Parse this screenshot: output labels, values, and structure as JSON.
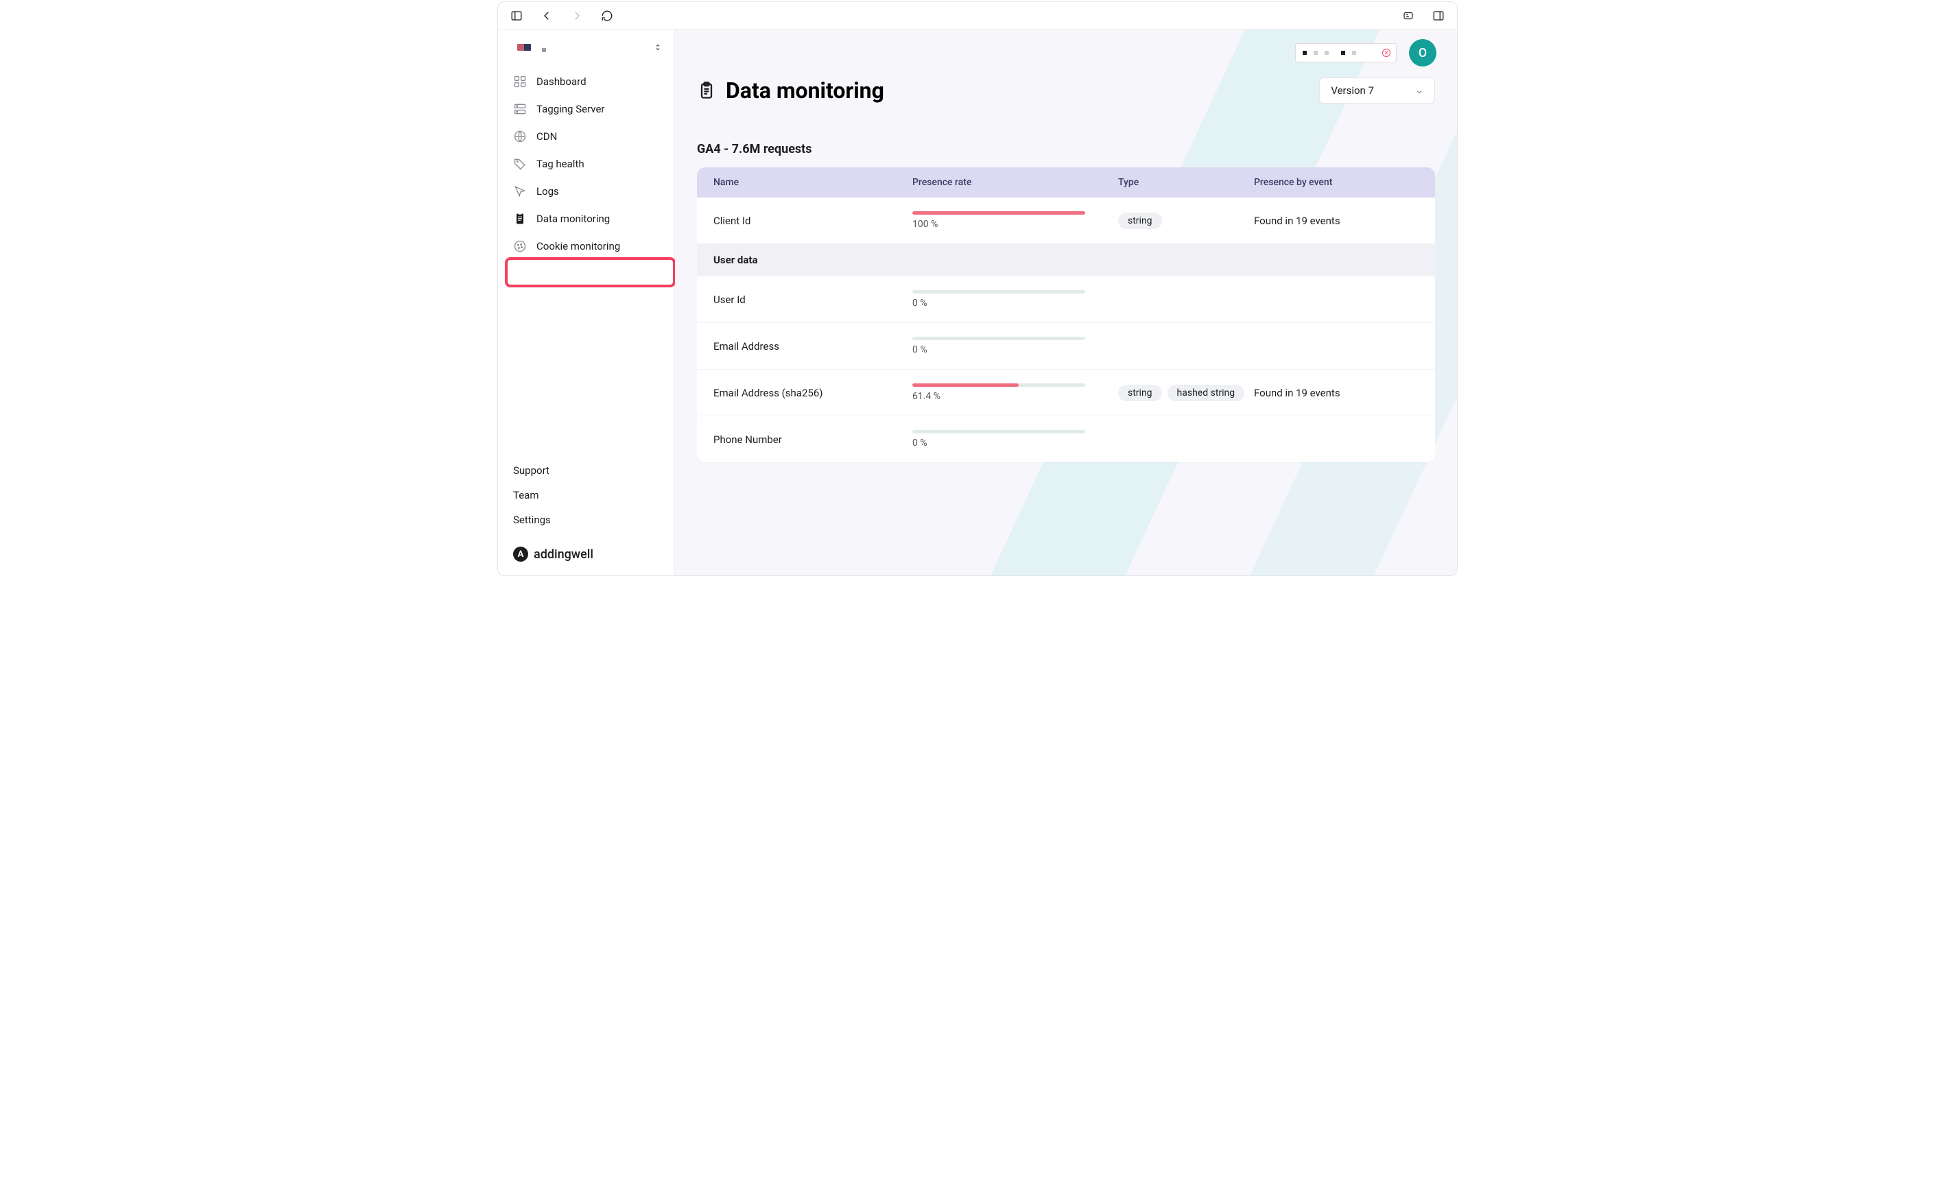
{
  "chromeIcons": [
    "sidebar",
    "back",
    "forward",
    "reload",
    "zoom",
    "panels"
  ],
  "sidebar": {
    "items": [
      {
        "icon": "dashboard-icon",
        "label": "Dashboard"
      },
      {
        "icon": "server-icon",
        "label": "Tagging Server"
      },
      {
        "icon": "globe-icon",
        "label": "CDN"
      },
      {
        "icon": "tag-icon",
        "label": "Tag health"
      },
      {
        "icon": "cursor-icon",
        "label": "Logs"
      },
      {
        "icon": "clipboard-icon",
        "label": "Data monitoring"
      },
      {
        "icon": "cookie-icon",
        "label": "Cookie monitoring"
      }
    ],
    "bottom": [
      "Support",
      "Team",
      "Settings"
    ],
    "brand": "addingwell"
  },
  "avatarInitial": "O",
  "page": {
    "title": "Data monitoring",
    "versionLabel": "Version 7",
    "sectionTitle": "GA4 - 7.6M requests",
    "columns": [
      "Name",
      "Presence rate",
      "Type",
      "Presence by event"
    ],
    "rows": [
      {
        "name": "Client Id",
        "rate": 100,
        "rateLabel": "100 %",
        "types": [
          "string"
        ],
        "events": "Found in 19 events"
      },
      {
        "group": "User data"
      },
      {
        "name": "User Id",
        "rate": 0,
        "rateLabel": "0 %",
        "types": [],
        "events": ""
      },
      {
        "name": "Email Address",
        "rate": 0,
        "rateLabel": "0 %",
        "types": [],
        "events": ""
      },
      {
        "name": "Email Address (sha256)",
        "rate": 61.4,
        "rateLabel": "61.4 %",
        "types": [
          "string",
          "hashed string"
        ],
        "events": "Found in 19 events"
      },
      {
        "name": "Phone Number",
        "rate": 0,
        "rateLabel": "0 %",
        "types": [],
        "events": ""
      }
    ]
  }
}
